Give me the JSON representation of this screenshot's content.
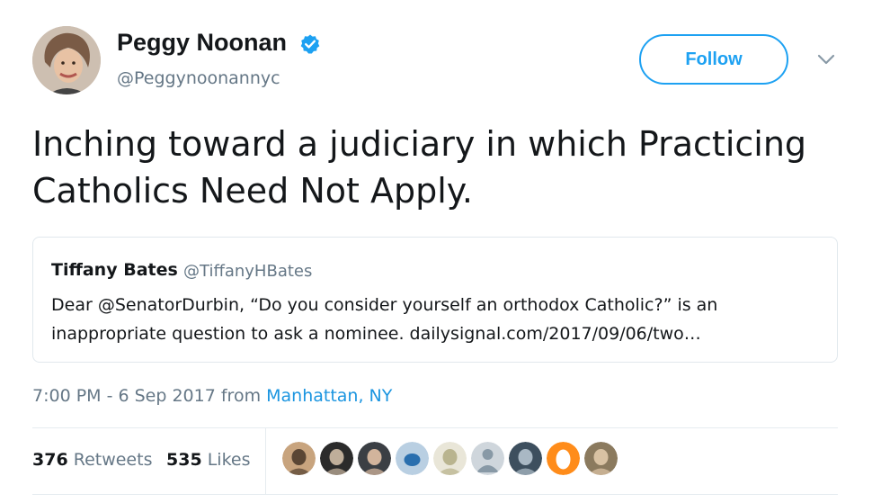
{
  "author": {
    "name": "Peggy Noonan",
    "handle": "@Peggynoonannyc",
    "verified_color": "#1da1f2"
  },
  "actions": {
    "follow_label": "Follow"
  },
  "tweet": {
    "text": "Inching toward a judiciary in which Practicing Catholics Need Not Apply."
  },
  "quoted": {
    "name": "Tiffany Bates",
    "handle": "@TiffanyHBates",
    "text": "Dear @SenatorDurbin, “Do you consider yourself an orthodox Catholic?” is an inappropriate question to ask a nominee. dailysignal.com/2017/09/06/two…"
  },
  "meta": {
    "time": "7:00 PM - 6 Sep 2017 from ",
    "location": "Manhattan, NY"
  },
  "stats": {
    "retweets_count": "376",
    "retweets_label": "Retweets",
    "likes_count": "535",
    "likes_label": "Likes"
  },
  "likers": [
    {
      "icon": "avatar-man-hat",
      "colors": [
        "#c8a47e",
        "#5a4634"
      ]
    },
    {
      "icon": "avatar-dark-portrait",
      "colors": [
        "#2b2b2b",
        "#bfae9a"
      ]
    },
    {
      "icon": "avatar-man-glasses",
      "colors": [
        "#3b3f44",
        "#d2b49c"
      ]
    },
    {
      "icon": "avatar-bird",
      "colors": [
        "#b9cfe2",
        "#2a6fae"
      ]
    },
    {
      "icon": "avatar-flower",
      "colors": [
        "#e9e6d8",
        "#b9b48f"
      ]
    },
    {
      "icon": "avatar-default-person",
      "colors": [
        "#cfd6dc",
        "#8899a6"
      ]
    },
    {
      "icon": "avatar-group-photo",
      "colors": [
        "#3d4f5e",
        "#a9b8c4"
      ]
    },
    {
      "icon": "avatar-orange-egg",
      "colors": [
        "#ff8c1a",
        "#ffffff"
      ]
    },
    {
      "icon": "avatar-woman-portrait",
      "colors": [
        "#8b7a5e",
        "#d9c2a3"
      ]
    }
  ],
  "colors": {
    "accent": "#1da1f2",
    "secondary_text": "#657786",
    "link": "#1b95e0"
  }
}
